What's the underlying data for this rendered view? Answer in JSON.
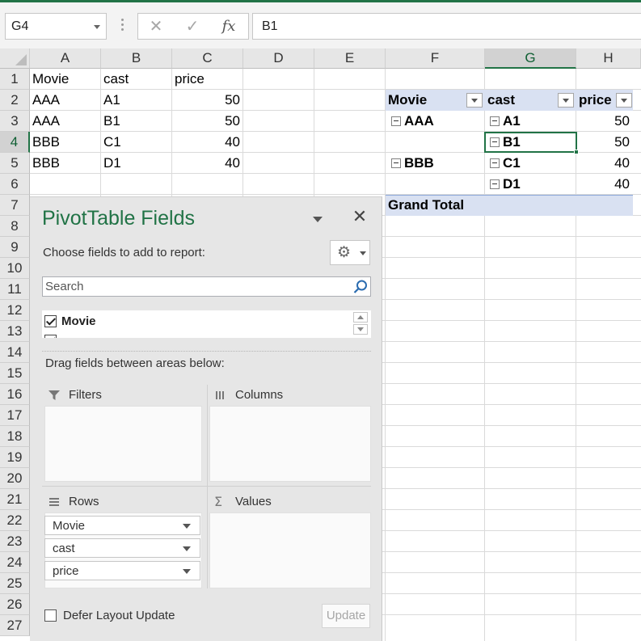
{
  "formula_bar": {
    "name_box": "G4",
    "cancel_glyph": "✕",
    "enter_glyph": "✓",
    "fx_label": "fx",
    "content": "B1"
  },
  "columns": [
    "A",
    "B",
    "C",
    "D",
    "E",
    "F",
    "G",
    "H"
  ],
  "selected_column": "G",
  "rows": [
    "1",
    "2",
    "3",
    "4",
    "5",
    "6",
    "7",
    "8",
    "9",
    "10",
    "11",
    "12",
    "13",
    "14",
    "15",
    "16",
    "17",
    "18",
    "19",
    "20",
    "21",
    "22",
    "23",
    "24",
    "25",
    "26",
    "27"
  ],
  "selected_row": "4",
  "source_table": {
    "headers": [
      "Movie",
      "cast",
      "price"
    ],
    "rows": [
      [
        "AAA",
        "A1",
        "50"
      ],
      [
        "AAA",
        "B1",
        "50"
      ],
      [
        "BBB",
        "C1",
        "40"
      ],
      [
        "BBB",
        "D1",
        "40"
      ]
    ]
  },
  "pivot_table": {
    "headers": [
      "Movie",
      "cast",
      "price"
    ],
    "groups": [
      {
        "movie": "AAA",
        "items": [
          {
            "cast": "A1",
            "price": "50"
          },
          {
            "cast": "B1",
            "price": "50"
          }
        ]
      },
      {
        "movie": "BBB",
        "items": [
          {
            "cast": "C1",
            "price": "40"
          },
          {
            "cast": "D1",
            "price": "40"
          }
        ]
      }
    ],
    "grand_total": "Grand Total"
  },
  "panel": {
    "title": "PivotTable Fields",
    "choose_label": "Choose fields to add to report:",
    "search_placeholder": "Search",
    "fields": [
      {
        "label": "Movie",
        "checked": true
      }
    ],
    "drag_label": "Drag fields between areas below:",
    "areas": {
      "filters": "Filters",
      "columns": "Columns",
      "rows": "Rows",
      "values": "Values"
    },
    "row_fields": [
      "Movie",
      "cast",
      "price"
    ],
    "defer_label": "Defer Layout Update",
    "update_label": "Update"
  },
  "colors": {
    "accent": "#217346",
    "pivot_header": "#d9e1f2",
    "panel_bg": "#e6e6e6"
  },
  "icons": [
    "chevron-down-icon",
    "close-icon",
    "gear-icon",
    "search-icon",
    "filter-icon",
    "columns-icon",
    "rows-icon",
    "sigma-icon",
    "collapse-icon",
    "checkbox-icon"
  ]
}
